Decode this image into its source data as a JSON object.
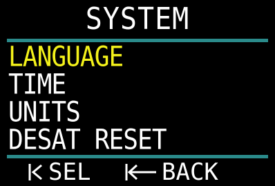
{
  "header": {
    "title": "SYSTEM"
  },
  "menu": {
    "items": [
      {
        "label": "LANGUAGE",
        "selected": true
      },
      {
        "label": "TIME",
        "selected": false
      },
      {
        "label": "UNITS",
        "selected": false
      },
      {
        "label": "DESAT RESET",
        "selected": false
      }
    ]
  },
  "softkeys": {
    "sel_label": "SEL",
    "back_label": "BACK",
    "sel_icon": "select-arrow-icon",
    "back_icon": "back-arrow-icon"
  },
  "colors": {
    "background": "#000000",
    "text": "#ffffff",
    "selected": "#f4f21a",
    "divider": "#2a8a8a"
  }
}
